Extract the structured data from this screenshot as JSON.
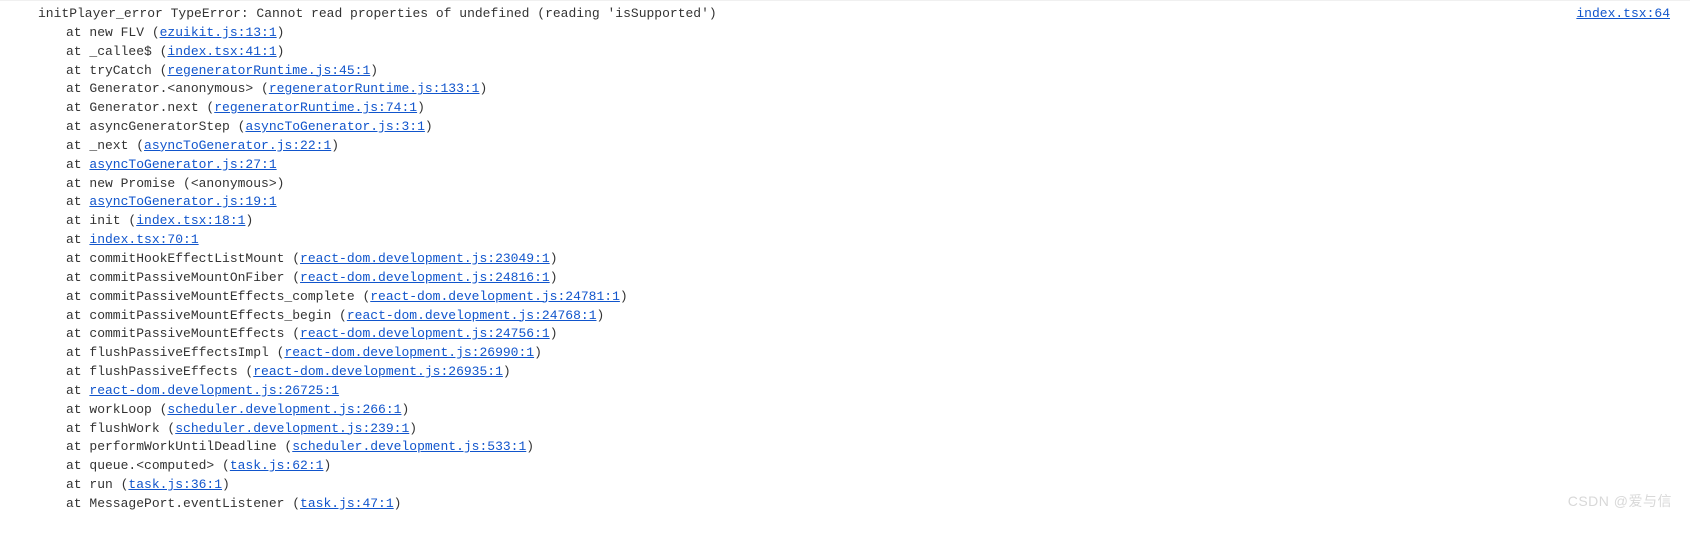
{
  "error": {
    "message": "initPlayer_error TypeError: Cannot read properties of undefined (reading 'isSupported')",
    "source": "index.tsx:64"
  },
  "stack": [
    {
      "prefix": "at new FLV (",
      "link": "ezuikit.js:13:1",
      "suffix": ")"
    },
    {
      "prefix": "at _callee$ (",
      "link": "index.tsx:41:1",
      "suffix": ")"
    },
    {
      "prefix": "at tryCatch (",
      "link": "regeneratorRuntime.js:45:1",
      "suffix": ")"
    },
    {
      "prefix": "at Generator.<anonymous> (",
      "link": "regeneratorRuntime.js:133:1",
      "suffix": ")"
    },
    {
      "prefix": "at Generator.next (",
      "link": "regeneratorRuntime.js:74:1",
      "suffix": ")"
    },
    {
      "prefix": "at asyncGeneratorStep (",
      "link": "asyncToGenerator.js:3:1",
      "suffix": ")"
    },
    {
      "prefix": "at _next (",
      "link": "asyncToGenerator.js:22:1",
      "suffix": ")"
    },
    {
      "prefix": "at ",
      "link": "asyncToGenerator.js:27:1",
      "suffix": ""
    },
    {
      "prefix": "at new Promise (<anonymous>)",
      "link": "",
      "suffix": ""
    },
    {
      "prefix": "at ",
      "link": "asyncToGenerator.js:19:1",
      "suffix": ""
    },
    {
      "prefix": "at init (",
      "link": "index.tsx:18:1",
      "suffix": ")"
    },
    {
      "prefix": "at ",
      "link": "index.tsx:70:1",
      "suffix": ""
    },
    {
      "prefix": "at commitHookEffectListMount (",
      "link": "react-dom.development.js:23049:1",
      "suffix": ")"
    },
    {
      "prefix": "at commitPassiveMountOnFiber (",
      "link": "react-dom.development.js:24816:1",
      "suffix": ")"
    },
    {
      "prefix": "at commitPassiveMountEffects_complete (",
      "link": "react-dom.development.js:24781:1",
      "suffix": ")"
    },
    {
      "prefix": "at commitPassiveMountEffects_begin (",
      "link": "react-dom.development.js:24768:1",
      "suffix": ")"
    },
    {
      "prefix": "at commitPassiveMountEffects (",
      "link": "react-dom.development.js:24756:1",
      "suffix": ")"
    },
    {
      "prefix": "at flushPassiveEffectsImpl (",
      "link": "react-dom.development.js:26990:1",
      "suffix": ")"
    },
    {
      "prefix": "at flushPassiveEffects (",
      "link": "react-dom.development.js:26935:1",
      "suffix": ")"
    },
    {
      "prefix": "at ",
      "link": "react-dom.development.js:26725:1",
      "suffix": ""
    },
    {
      "prefix": "at workLoop (",
      "link": "scheduler.development.js:266:1",
      "suffix": ")"
    },
    {
      "prefix": "at flushWork (",
      "link": "scheduler.development.js:239:1",
      "suffix": ")"
    },
    {
      "prefix": "at performWorkUntilDeadline (",
      "link": "scheduler.development.js:533:1",
      "suffix": ")"
    },
    {
      "prefix": "at queue.<computed> (",
      "link": "task.js:62:1",
      "suffix": ")"
    },
    {
      "prefix": "at run (",
      "link": "task.js:36:1",
      "suffix": ")"
    },
    {
      "prefix": "at MessagePort.eventListener (",
      "link": "task.js:47:1",
      "suffix": ")"
    }
  ],
  "watermark": "CSDN @爱与信"
}
